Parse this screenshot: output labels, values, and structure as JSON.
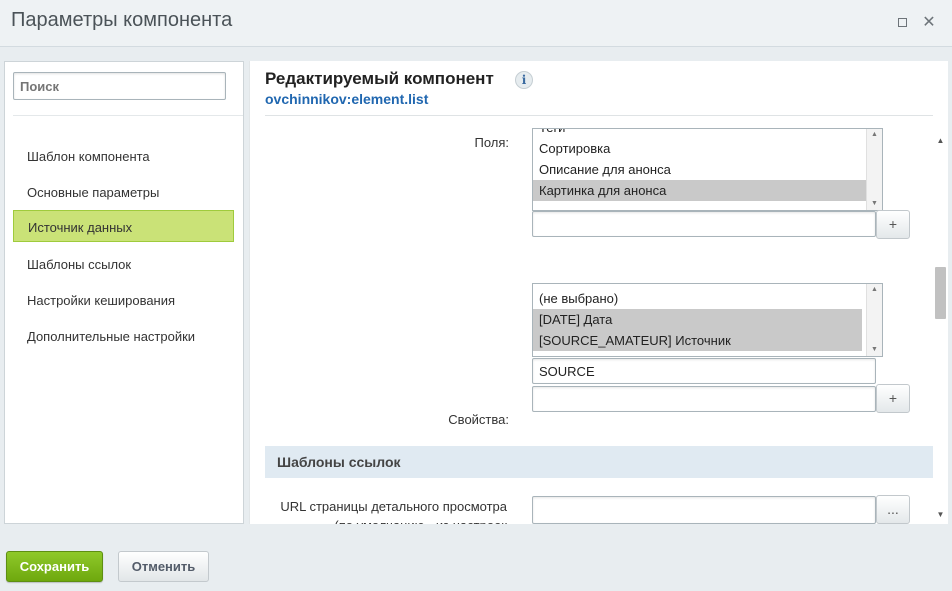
{
  "window": {
    "title": "Параметры компонента"
  },
  "sidebar": {
    "search_placeholder": "Поиск",
    "items": [
      {
        "label": "Шаблон компонента"
      },
      {
        "label": "Основные параметры"
      },
      {
        "label": "Источник данных",
        "active": true
      },
      {
        "label": "Шаблоны ссылок"
      },
      {
        "label": "Настройки кеширования"
      },
      {
        "label": "Дополнительные настройки"
      }
    ]
  },
  "header": {
    "title": "Редактируемый компонент",
    "component_id": "ovchinnikov:element.list",
    "info_glyph": "i"
  },
  "fields": {
    "label": "Поля:",
    "options": [
      {
        "text": "Теги",
        "selected": false
      },
      {
        "text": "Сортировка",
        "selected": false
      },
      {
        "text": "Описание для анонса",
        "selected": false
      },
      {
        "text": "Картинка для анонса",
        "selected": true
      }
    ],
    "input_value": "",
    "add_label": "+"
  },
  "properties": {
    "label": "Свойства:",
    "options": [
      {
        "text": "(не выбрано)",
        "selected": false
      },
      {
        "text": "[DATE] Дата",
        "selected": true
      },
      {
        "text": "[SOURCE_AMATEUR] Источник",
        "selected": true
      }
    ],
    "input_value": "SOURCE",
    "input2_value": "",
    "add_label": "+"
  },
  "link_templates": {
    "section_title": "Шаблоны ссылок",
    "detail_url_label_line1": "URL страницы детального просмотра",
    "detail_url_label_line2": "(по умолчанию - из настроек",
    "detail_url_value": "",
    "browse_label": "..."
  },
  "footer": {
    "save_label": "Сохранить",
    "cancel_label": "Отменить"
  },
  "colors": {
    "save_green": "#7ab51d",
    "active_item": "#cae277",
    "link_blue": "#2067b0",
    "section_bg": "#e0eaf2"
  },
  "icons": {
    "maximize": "maximize-icon",
    "close": "close-icon",
    "info": "info-icon"
  }
}
